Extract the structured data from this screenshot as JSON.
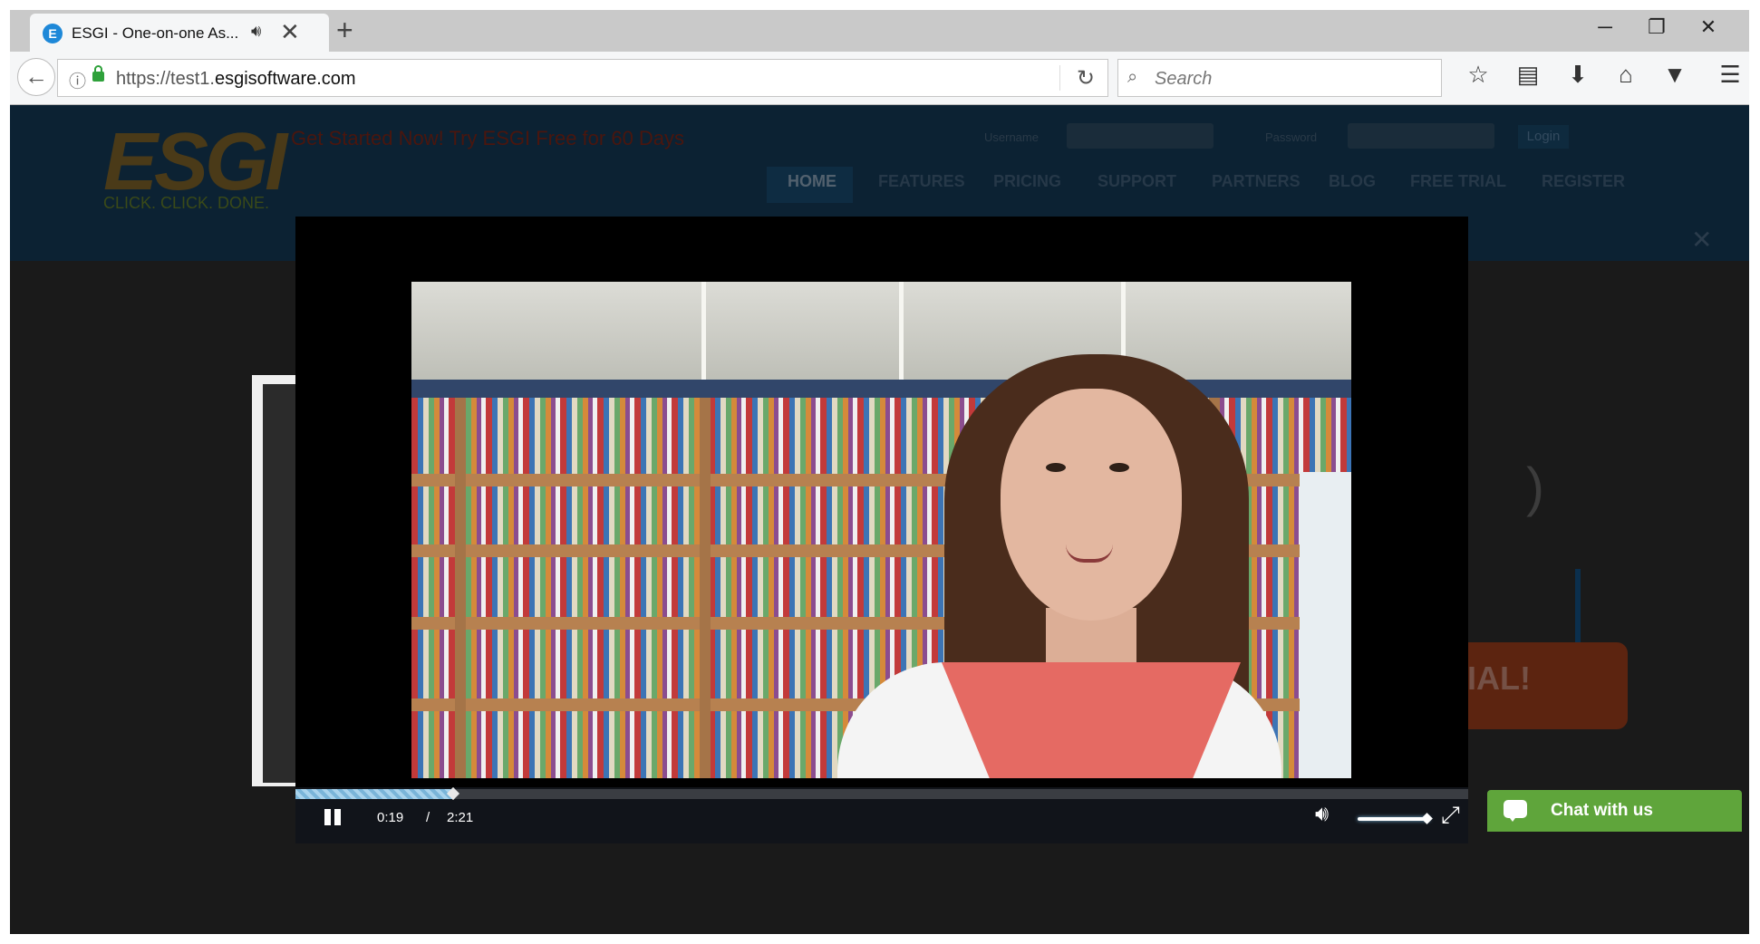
{
  "browser": {
    "tab": {
      "title": "ESGI - One-on-one As...",
      "favicon_letter": "E",
      "audio_icon": "speaker-icon",
      "close_glyph": "✕"
    },
    "new_tab_glyph": "+",
    "window_controls": {
      "minimize": "─",
      "restore": "❐",
      "close": "✕"
    },
    "url": {
      "prefix": "https://test1.",
      "host": "esgisoftware.com"
    },
    "search_placeholder": "Search",
    "toolbar_icons": [
      "bookmark-star-icon",
      "reading-list-icon",
      "downloads-icon",
      "home-icon",
      "pocket-icon",
      "menu-icon"
    ]
  },
  "site": {
    "promo": "Get Started Now! Try ESGI Free for 60 Days",
    "logo_text": "ESGI",
    "logo_tagline": "CLICK. CLICK. DONE.",
    "username_label": "Username",
    "password_label": "Password",
    "login_label": "Login",
    "nav": [
      "HOME",
      "FEATURES",
      "PRICING",
      "SUPPORT",
      "PARTNERS",
      "BLOG",
      "FREE TRIAL",
      "REGISTER"
    ],
    "cta_partial": "IAL!"
  },
  "player": {
    "current_time": "0:19",
    "separator": "/",
    "duration": "2:21",
    "progress_fraction": 0.135,
    "volume_fraction": 1.0,
    "accent_color": "#7ab5d9"
  },
  "chat": {
    "label": "Chat with us",
    "color": "#5fa53b"
  }
}
